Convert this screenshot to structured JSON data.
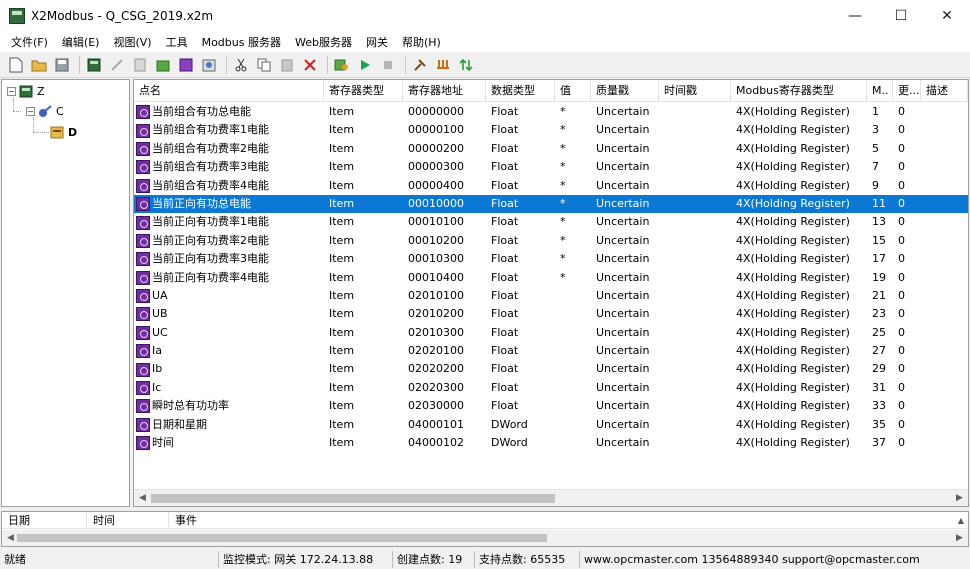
{
  "window": {
    "title": "X2Modbus - Q_CSG_2019.x2m",
    "minimize": "—",
    "maximize": "☐",
    "close": "✕"
  },
  "menu": [
    "文件(F)",
    "编辑(E)",
    "视图(V)",
    "工具",
    "Modbus 服务器",
    "Web服务器",
    "网关",
    "帮助(H)"
  ],
  "toolbar": {
    "buttons": [
      "new-file-icon",
      "open-folder-icon",
      "save-icon",
      "add-server-icon",
      "connect-icon",
      "add-group-icon",
      "add-item-icon",
      "add-items-icon",
      "properties-icon",
      "cut-icon",
      "copy-icon",
      "paste-icon",
      "delete-icon",
      "monitor-icon",
      "run-icon",
      "stop-icon",
      "tools-icon",
      "import-icon",
      "export-icon"
    ]
  },
  "tree": {
    "root": "Z",
    "child": "C",
    "leaf": "D"
  },
  "table": {
    "columns": [
      "点名",
      "寄存器类型",
      "寄存器地址",
      "数据类型",
      "值",
      "质量戳",
      "时间戳",
      "Modbus寄存器类型",
      "M..",
      "更...",
      "描述"
    ],
    "selected_row": 5,
    "rows": [
      [
        "当前组合有功总电能",
        "Item",
        "00000000",
        "Float",
        "*",
        "Uncertain",
        "",
        "4X(Holding Register)",
        "1",
        "0",
        ""
      ],
      [
        "当前组合有功费率1电能",
        "Item",
        "00000100",
        "Float",
        "*",
        "Uncertain",
        "",
        "4X(Holding Register)",
        "3",
        "0",
        ""
      ],
      [
        "当前组合有功费率2电能",
        "Item",
        "00000200",
        "Float",
        "*",
        "Uncertain",
        "",
        "4X(Holding Register)",
        "5",
        "0",
        ""
      ],
      [
        "当前组合有功费率3电能",
        "Item",
        "00000300",
        "Float",
        "*",
        "Uncertain",
        "",
        "4X(Holding Register)",
        "7",
        "0",
        ""
      ],
      [
        "当前组合有功费率4电能",
        "Item",
        "00000400",
        "Float",
        "*",
        "Uncertain",
        "",
        "4X(Holding Register)",
        "9",
        "0",
        ""
      ],
      [
        "当前正向有功总电能",
        "Item",
        "00010000",
        "Float",
        "*",
        "Uncertain",
        "",
        "4X(Holding Register)",
        "11",
        "0",
        ""
      ],
      [
        "当前正向有功费率1电能",
        "Item",
        "00010100",
        "Float",
        "*",
        "Uncertain",
        "",
        "4X(Holding Register)",
        "13",
        "0",
        ""
      ],
      [
        "当前正向有功费率2电能",
        "Item",
        "00010200",
        "Float",
        "*",
        "Uncertain",
        "",
        "4X(Holding Register)",
        "15",
        "0",
        ""
      ],
      [
        "当前正向有功费率3电能",
        "Item",
        "00010300",
        "Float",
        "*",
        "Uncertain",
        "",
        "4X(Holding Register)",
        "17",
        "0",
        ""
      ],
      [
        "当前正向有功费率4电能",
        "Item",
        "00010400",
        "Float",
        "*",
        "Uncertain",
        "",
        "4X(Holding Register)",
        "19",
        "0",
        ""
      ],
      [
        "UA",
        "Item",
        "02010100",
        "Float",
        "",
        "Uncertain",
        "",
        "4X(Holding Register)",
        "21",
        "0",
        ""
      ],
      [
        "UB",
        "Item",
        "02010200",
        "Float",
        "",
        "Uncertain",
        "",
        "4X(Holding Register)",
        "23",
        "0",
        ""
      ],
      [
        "UC",
        "Item",
        "02010300",
        "Float",
        "",
        "Uncertain",
        "",
        "4X(Holding Register)",
        "25",
        "0",
        ""
      ],
      [
        "Ia",
        "Item",
        "02020100",
        "Float",
        "",
        "Uncertain",
        "",
        "4X(Holding Register)",
        "27",
        "0",
        ""
      ],
      [
        "Ib",
        "Item",
        "02020200",
        "Float",
        "",
        "Uncertain",
        "",
        "4X(Holding Register)",
        "29",
        "0",
        ""
      ],
      [
        "Ic",
        "Item",
        "02020300",
        "Float",
        "",
        "Uncertain",
        "",
        "4X(Holding Register)",
        "31",
        "0",
        ""
      ],
      [
        "瞬时总有功功率",
        "Item",
        "02030000",
        "Float",
        "",
        "Uncertain",
        "",
        "4X(Holding Register)",
        "33",
        "0",
        ""
      ],
      [
        "日期和星期",
        "Item",
        "04000101",
        "DWord",
        "",
        "Uncertain",
        "",
        "4X(Holding Register)",
        "35",
        "0",
        ""
      ],
      [
        "时间",
        "Item",
        "04000102",
        "DWord",
        "",
        "Uncertain",
        "",
        "4X(Holding Register)",
        "37",
        "0",
        ""
      ]
    ]
  },
  "log": {
    "columns": [
      "日期",
      "时间",
      "事件"
    ]
  },
  "status": {
    "ready": "就绪",
    "mode": "监控模式: 网关 172.24.13.88",
    "created": "创建点数: 19",
    "supported": "支持点数: 65535",
    "contact": "www.opcmaster.com 13564889340 support@opcmaster.com"
  },
  "colors": {
    "selection": "#0a78d4",
    "item_icon": "#6f2f9e"
  }
}
